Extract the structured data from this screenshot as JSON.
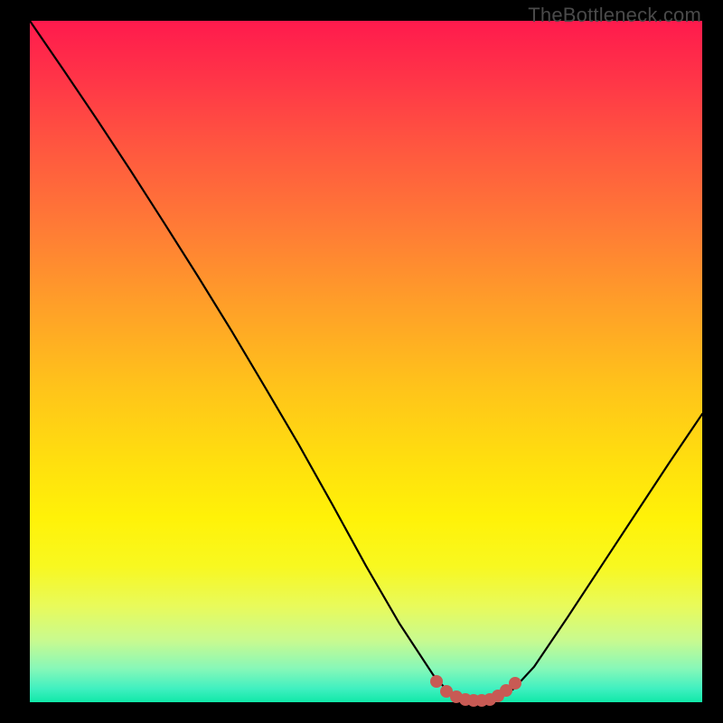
{
  "watermark": "TheBottleneck.com",
  "chart_data": {
    "type": "line",
    "title": "",
    "xlabel": "",
    "ylabel": "",
    "xlim": [
      0,
      100
    ],
    "ylim": [
      0,
      100
    ],
    "grid": false,
    "legend": false,
    "series": [
      {
        "name": "curve",
        "x": [
          0,
          5,
          10,
          15,
          20,
          25,
          30,
          35,
          40,
          45,
          50,
          55,
          60,
          62,
          64,
          66,
          68,
          70,
          72,
          75,
          80,
          85,
          90,
          95,
          100
        ],
        "y": [
          100,
          92.8,
          85.5,
          78.0,
          70.3,
          62.5,
          54.5,
          46.2,
          37.8,
          29.0,
          20.0,
          11.5,
          4.0,
          1.8,
          0.6,
          0.2,
          0.2,
          0.7,
          2.0,
          5.2,
          12.5,
          20.0,
          27.5,
          35.0,
          42.3
        ]
      }
    ],
    "markers": {
      "name": "highlight",
      "color": "#c85a54",
      "x": [
        60.5,
        62.0,
        63.4,
        64.8,
        66.0,
        67.2,
        68.4,
        69.6,
        70.8,
        72.2
      ],
      "y": [
        3.0,
        1.6,
        0.8,
        0.4,
        0.2,
        0.2,
        0.4,
        0.9,
        1.7,
        2.8
      ]
    },
    "background_gradient": {
      "stops": [
        {
          "pos": 0.0,
          "color": "#ff1a4d"
        },
        {
          "pos": 0.5,
          "color": "#ffc41a"
        },
        {
          "pos": 0.8,
          "color": "#f8f820"
        },
        {
          "pos": 1.0,
          "color": "#10e8a8"
        }
      ]
    }
  }
}
